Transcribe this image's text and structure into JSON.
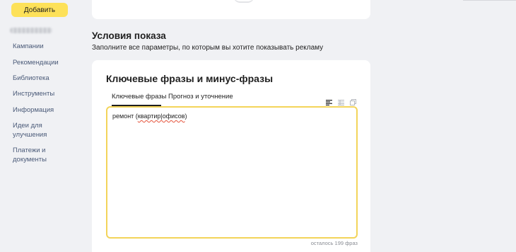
{
  "sidebar": {
    "add_button_label": "Добавить",
    "nav_items": [
      {
        "label": "Кампании"
      },
      {
        "label": "Рекомендации"
      },
      {
        "label": "Библиотека"
      },
      {
        "label": "Инструменты"
      },
      {
        "label": "Информация"
      },
      {
        "label": "Идеи для улучшения"
      },
      {
        "label": "Платежи и документы"
      }
    ]
  },
  "section": {
    "title": "Условия показа",
    "subtitle": "Заполните все параметры, по которым вы хотите показывать рекламу"
  },
  "keywords_card": {
    "title": "Ключевые фразы и минус-фразы",
    "tabs": [
      {
        "label": "Ключевые фразы",
        "active": true
      },
      {
        "label": "Прогноз и уточнение",
        "active": false
      }
    ],
    "view_icons": [
      "list-view-icon",
      "table-view-icon",
      "copy-icon"
    ],
    "phrases_prefix": "ремонт (",
    "phrases_underlined": "квартир|офисов",
    "phrases_suffix": ")",
    "remaining_text": "осталось 199 фраз",
    "accent_color": "#f3d45a"
  }
}
